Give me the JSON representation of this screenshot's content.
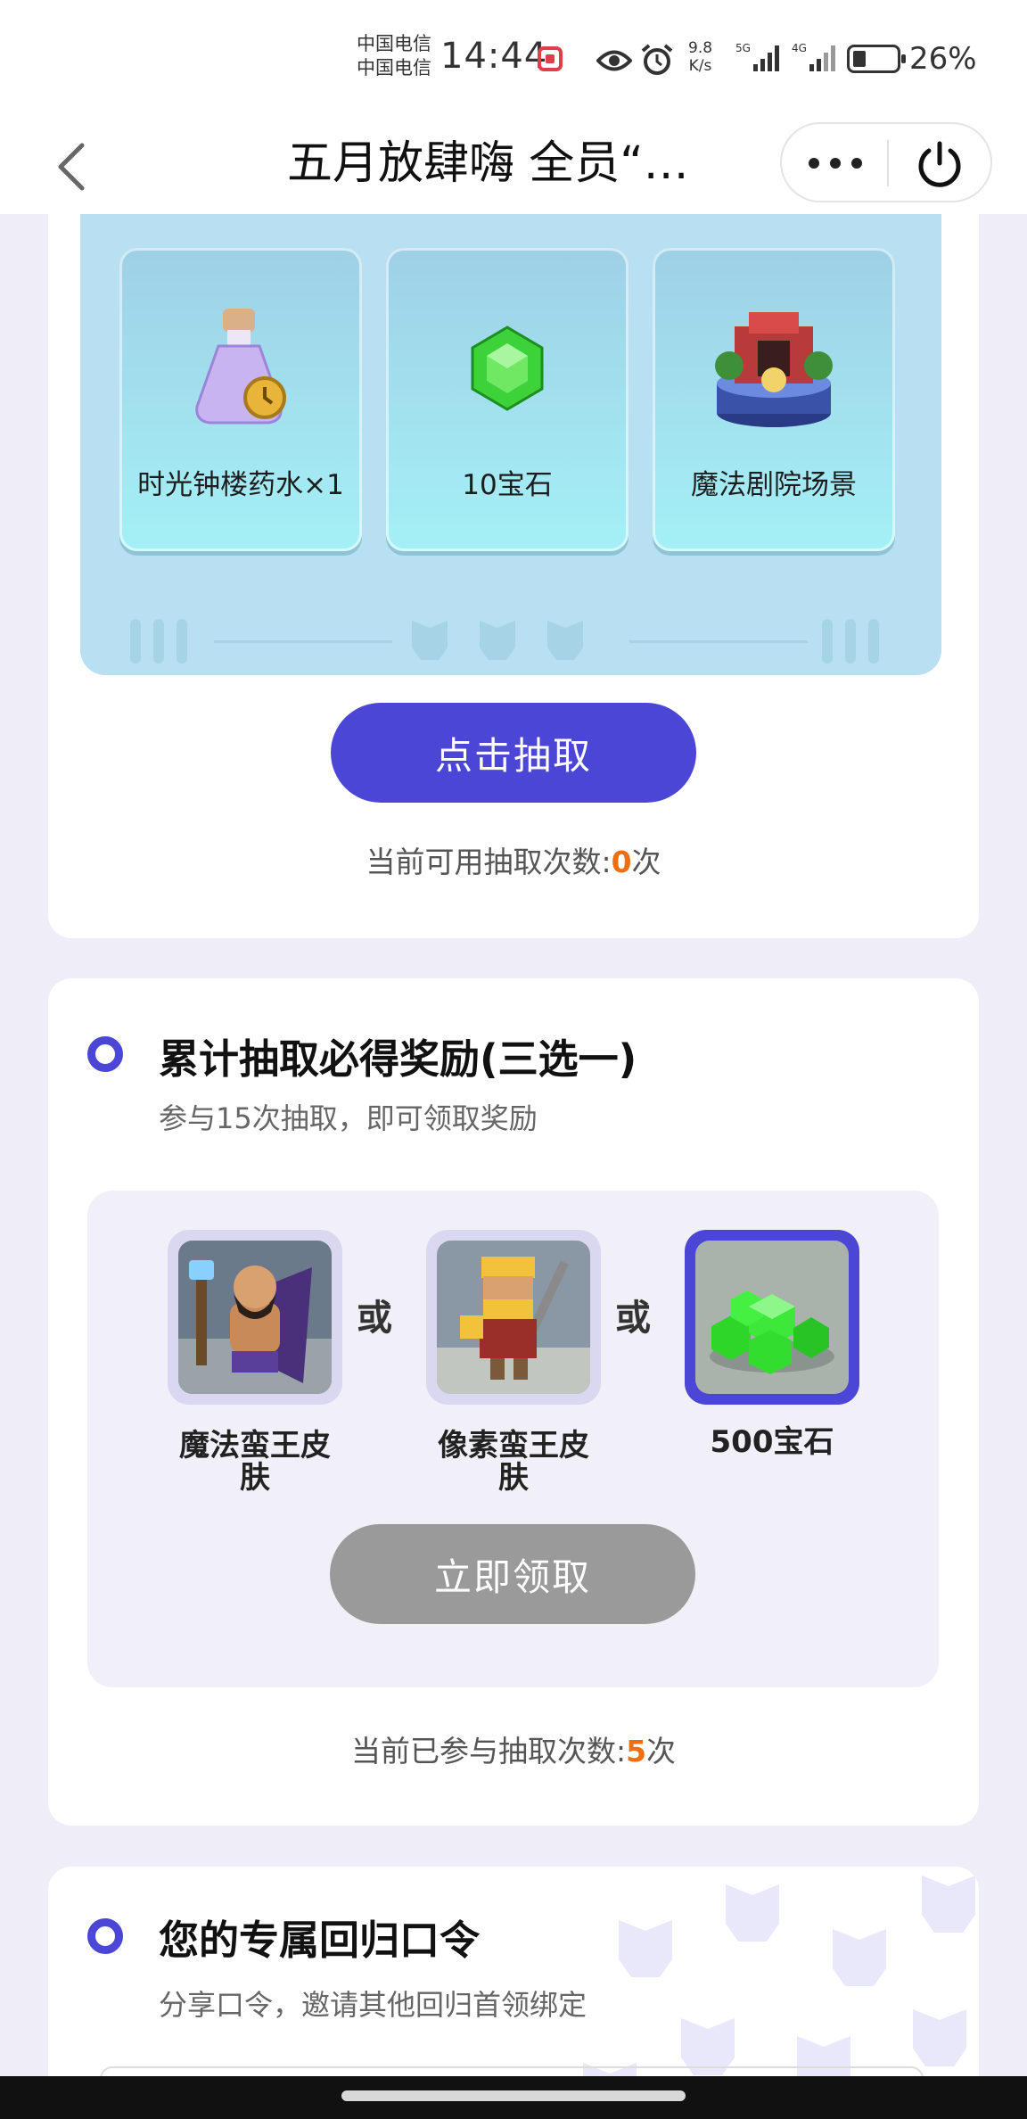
{
  "status_bar": {
    "carrier_line1": "中国电信",
    "carrier_line2": "中国电信",
    "time": "14:44",
    "net_speed_value": "9.8",
    "net_speed_unit": "K/s",
    "network_5g": "5G",
    "network_4g": "4G",
    "battery_percent": "26%",
    "battery_level": 0.26
  },
  "nav": {
    "title": "五月放肆嗨 全员“…"
  },
  "prize_pool": {
    "items": [
      {
        "label": "时光钟楼药水×1",
        "icon": "potion-icon"
      },
      {
        "label": "10宝石",
        "icon": "gem-icon"
      },
      {
        "label": "魔法剧院场景",
        "icon": "theater-scene-icon"
      }
    ],
    "draw_button": "点击抽取",
    "available_prefix": "当前可用抽取次数:",
    "available_count": "0",
    "available_suffix": "次"
  },
  "cumulative_reward": {
    "title": "累计抽取必得奖励(三选一)",
    "subtitle": "参与15次抽取，即可领取奖励",
    "options": [
      {
        "name": "魔法蛮王皮肤",
        "icon": "magic-barbarian-king-skin-icon",
        "selected": false
      },
      {
        "name": "像素蛮王皮肤",
        "icon": "pixel-barbarian-king-skin-icon",
        "selected": false
      },
      {
        "name": "500宝石",
        "icon": "gems-pile-icon",
        "selected": true
      }
    ],
    "or_word": "或",
    "claim_button": "立即领取",
    "joined_prefix": "当前已参与抽取次数:",
    "joined_count": "5",
    "joined_suffix": "次"
  },
  "referral": {
    "title": "您的专属回归口令",
    "subtitle": "分享口令，邀请其他回归首领绑定"
  },
  "colors": {
    "accent": "#4b46d6",
    "highlight": "#f06d10",
    "prize_panel": "#b8dff2",
    "disabled_button": "#9a9a9a"
  }
}
